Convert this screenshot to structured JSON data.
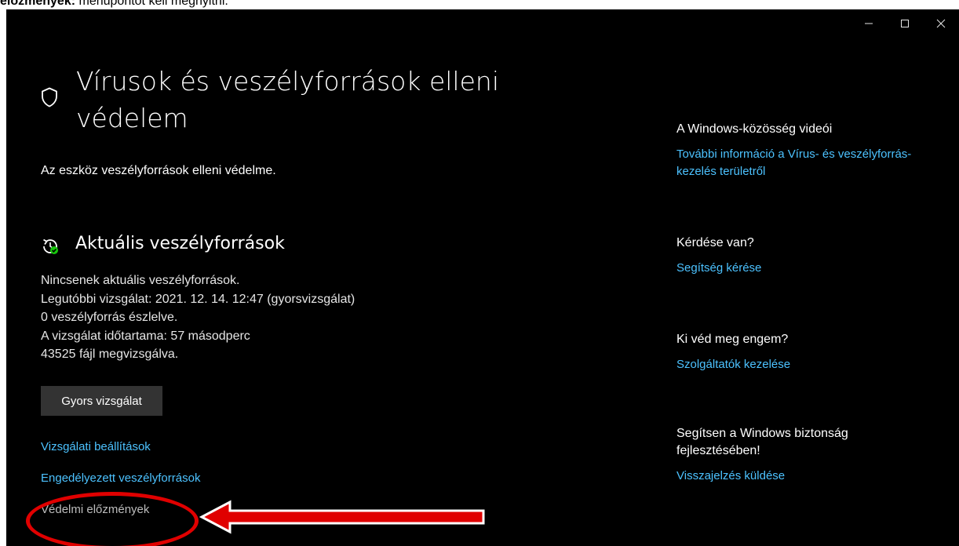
{
  "caption": {
    "bold_part": "előzmények:",
    "rest": " menüpontot kell megnyitni."
  },
  "window": {
    "controls": [
      "minimize",
      "maximize",
      "close"
    ]
  },
  "main": {
    "title": "Vírusok és veszélyforrások elleni védelem",
    "subtitle": "Az eszköz veszélyforrások elleni védelme.",
    "current_threats": {
      "title": "Aktuális veszélyforrások",
      "lines": [
        "Nincsenek aktuális veszélyforrások.",
        "Legutóbbi vizsgálat: 2021. 12. 14. 12:47 (gyorsvizsgálat)",
        "0 veszélyforrás észlelve.",
        "A vizsgálat időtartama: 57 másodperc",
        "43525 fájl megvizsgálva."
      ],
      "quick_scan_label": "Gyors vizsgálat",
      "links": {
        "scan_options": "Vizsgálati beállítások",
        "allowed_threats": "Engedélyezett veszélyforrások",
        "protection_history": "Védelmi előzmények"
      }
    }
  },
  "sidebar": {
    "community": {
      "heading": "A Windows-közösség videói",
      "link": "További információ a Vírus- és veszélyforrás-kezelés területről"
    },
    "question": {
      "heading": "Kérdése van?",
      "link": "Segítség kérése"
    },
    "who_protects": {
      "heading": "Ki véd meg engem?",
      "link": "Szolgáltatók kezelése"
    },
    "improve": {
      "heading": "Segítsen a Windows biztonság fejlesztésében!",
      "link": "Visszajelzés küldése"
    }
  },
  "colors": {
    "background": "#000000",
    "link": "#4cc2ff",
    "button": "#333333",
    "annotation": "#e00000"
  }
}
